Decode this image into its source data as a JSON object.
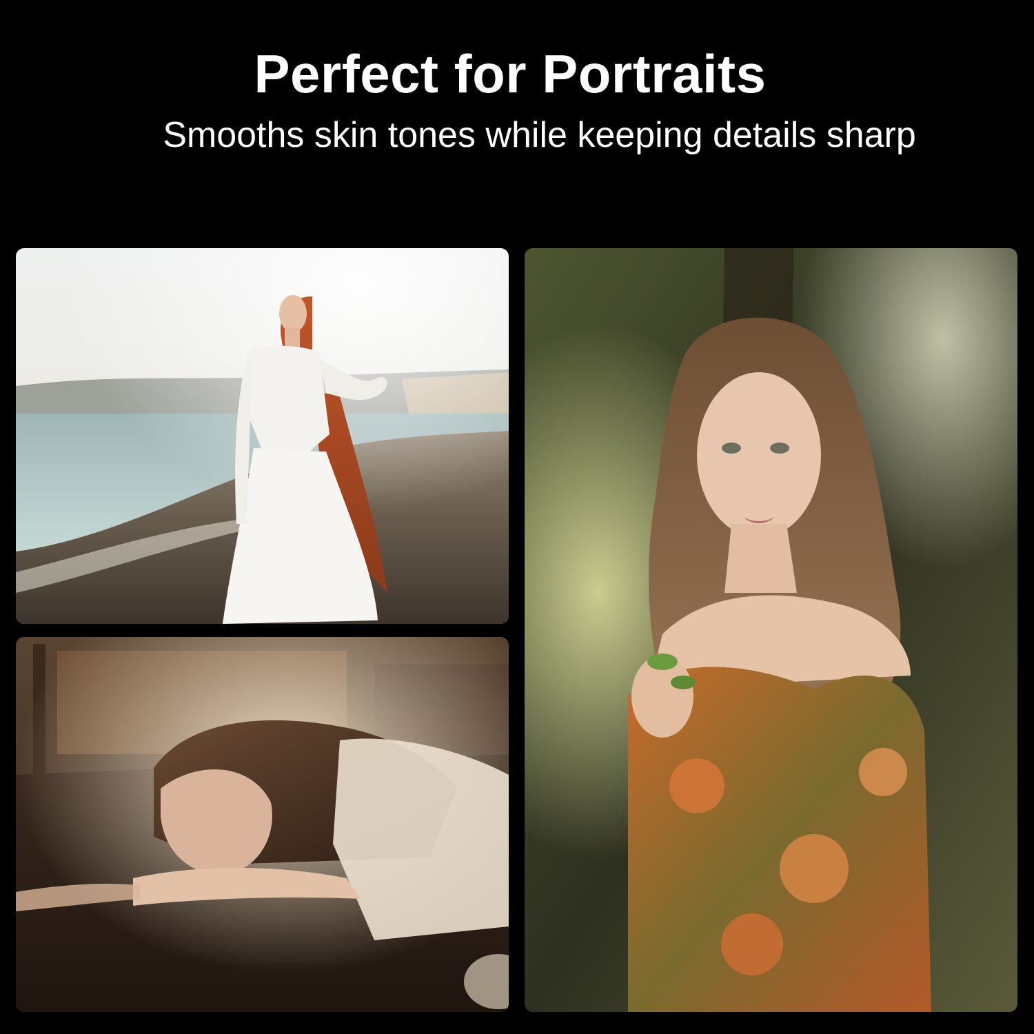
{
  "header": {
    "title": "Perfect for Portraits",
    "subtitle": "Smooths skin tones while keeping details sharp"
  },
  "colors": {
    "background": "#000000",
    "text": "#ffffff"
  },
  "photos": [
    {
      "id": "beach-portrait"
    },
    {
      "id": "table-portrait"
    },
    {
      "id": "forest-portrait"
    }
  ]
}
